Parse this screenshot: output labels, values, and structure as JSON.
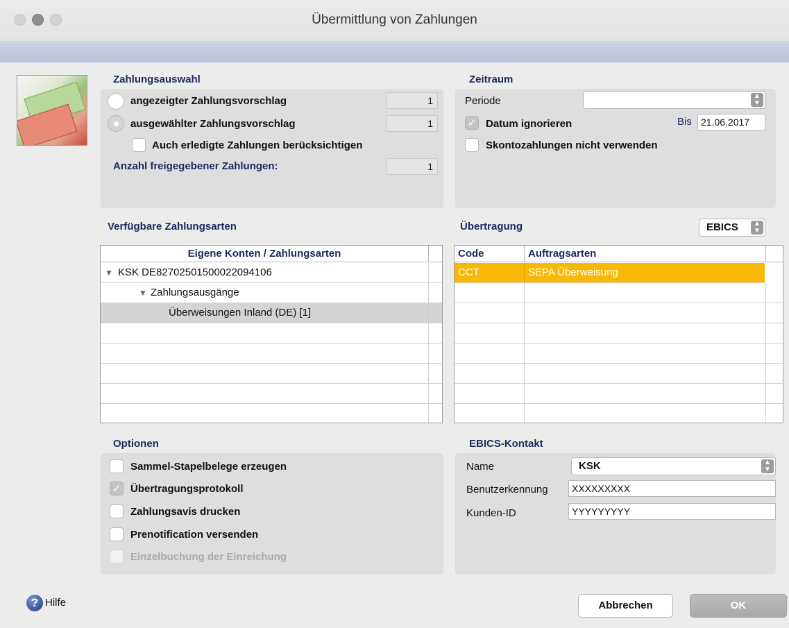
{
  "window": {
    "title": "Übermittlung von Zahlungen"
  },
  "zahlungsauswahl": {
    "title": "Zahlungsauswahl",
    "radio1_label": "angezeigter Zahlungsvorschlag",
    "radio1_value": "1",
    "radio2_label": "ausgewählter Zahlungsvorschlag",
    "radio2_value": "1",
    "checkbox_label": "Auch erledigte Zahlungen berücksichtigen",
    "count_label": "Anzahl freigegebener Zahlungen:",
    "count_value": "1"
  },
  "zeitraum": {
    "title": "Zeitraum",
    "periode_label": "Periode",
    "periode_value": "",
    "datum_label": "Datum ignorieren",
    "bis_label": "Bis",
    "bis_value": "21.06.2017",
    "skonto_label": "Skontozahlungen nicht verwenden"
  },
  "zahlungsarten": {
    "title": "Verfügbare Zahlungsarten",
    "header": "Eigene Konten / Zahlungsarten",
    "rows": [
      {
        "arrow": "▼",
        "text": "KSK  DE82702501500022094106"
      },
      {
        "arrow": "▼",
        "text": "Zahlungsausgänge"
      },
      {
        "arrow": "",
        "text": "Überweisungen Inland (DE) [1]"
      }
    ]
  },
  "uebertragung": {
    "title": "Übertragung",
    "select_value": "EBICS",
    "header_code": "Code",
    "header_auftrag": "Auftragsarten",
    "rows": [
      {
        "code": "CCT",
        "auftrag": "SEPA Überweisung"
      }
    ]
  },
  "optionen": {
    "title": "Optionen",
    "opt1": "Sammel-Stapelbelege erzeugen",
    "opt2": "Übertragungsprotokoll",
    "opt3": "Zahlungsavis drucken",
    "opt4": "Prenotification versenden",
    "opt5": "Einzelbuchung der Einreichung"
  },
  "ebics": {
    "title": "EBICS-Kontakt",
    "name_label": "Name",
    "name_value": "KSK",
    "benutzer_label": "Benutzerkennung",
    "benutzer_value": "XXXXXXXXX",
    "kunden_label": "Kunden-ID",
    "kunden_value": "YYYYYYYYY"
  },
  "footer": {
    "help_label": "Hilfe",
    "cancel_label": "Abbrechen",
    "ok_label": "OK"
  },
  "check_glyph": "✓",
  "help_glyph": "?"
}
